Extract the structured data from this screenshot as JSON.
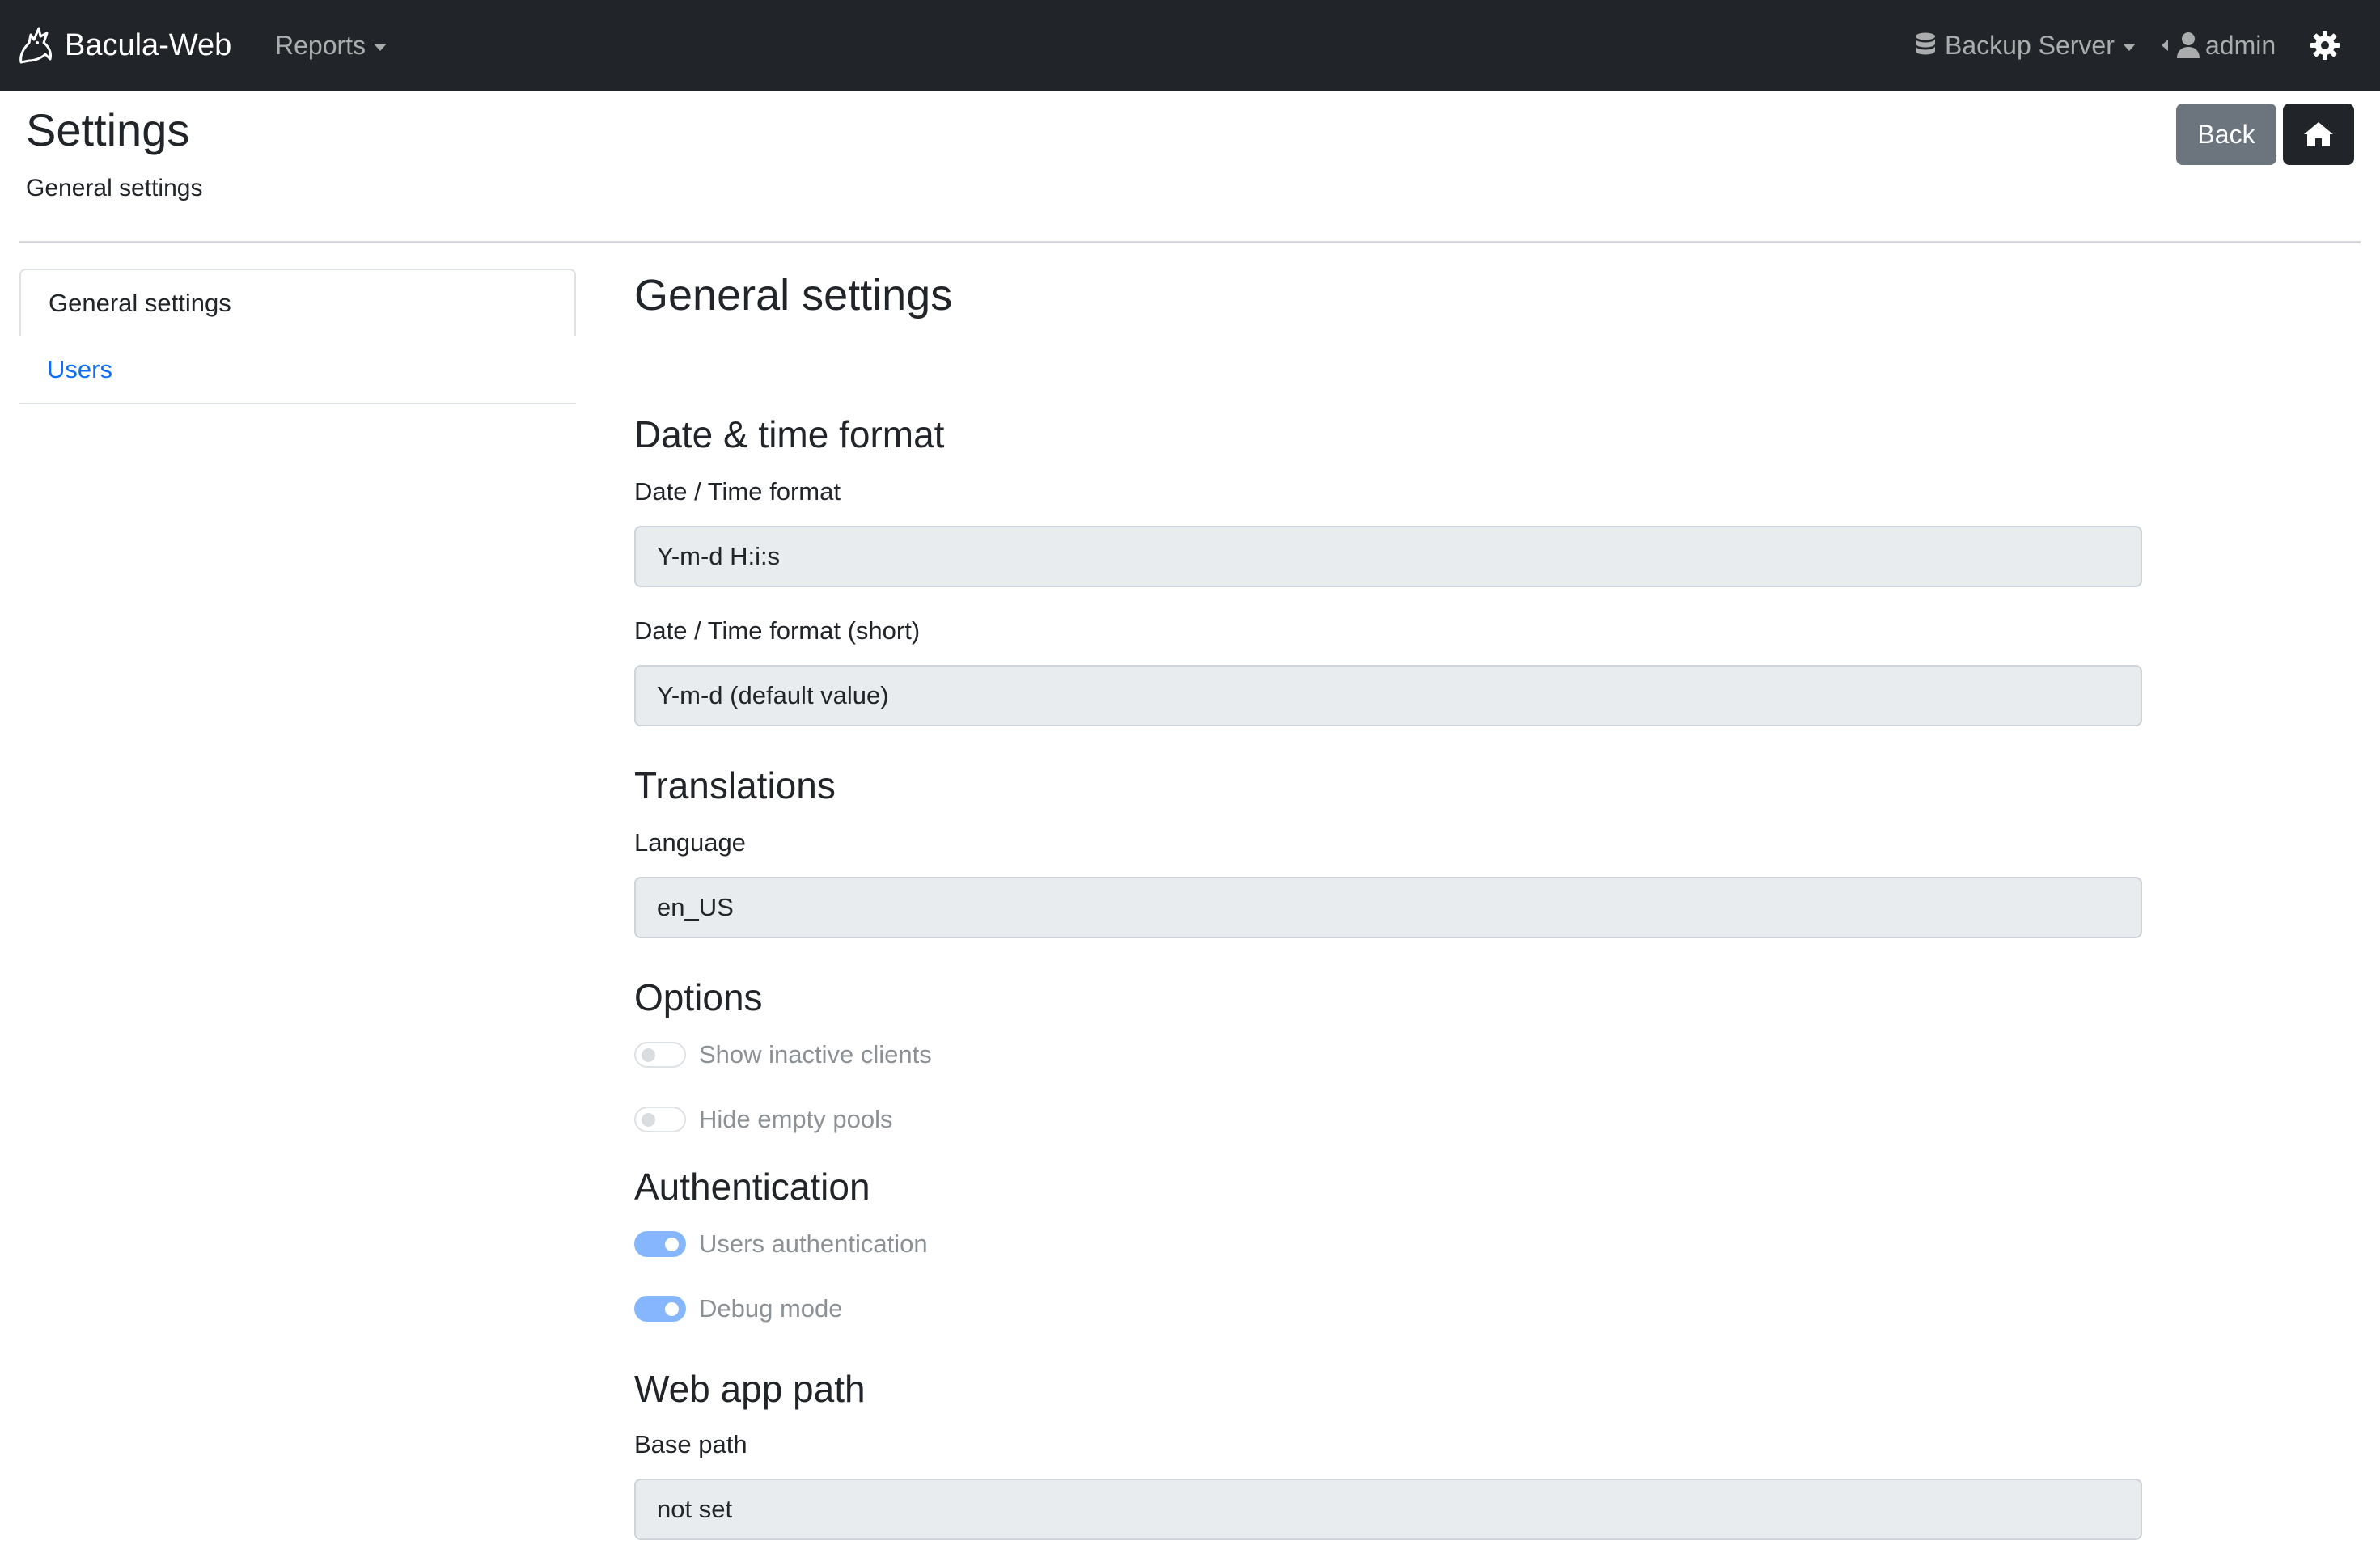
{
  "navbar": {
    "brand": "Bacula-Web",
    "reports_label": "Reports",
    "server_label": "Backup Server",
    "user_label": "admin"
  },
  "header": {
    "title": "Settings",
    "subtitle": "General settings",
    "back_label": "Back"
  },
  "sidebar": {
    "items": [
      {
        "label": "General settings",
        "active": true
      },
      {
        "label": "Users",
        "active": false
      }
    ]
  },
  "main": {
    "title": "General settings",
    "datetime": {
      "heading": "Date & time format",
      "format_label": "Date / Time format",
      "format_value": "Y-m-d H:i:s",
      "short_label": "Date / Time format (short)",
      "short_value": "Y-m-d (default value)"
    },
    "translations": {
      "heading": "Translations",
      "language_label": "Language",
      "language_value": "en_US"
    },
    "options": {
      "heading": "Options",
      "show_inactive_label": "Show inactive clients",
      "show_inactive_on": false,
      "hide_empty_label": "Hide empty pools",
      "hide_empty_on": false
    },
    "authentication": {
      "heading": "Authentication",
      "users_auth_label": "Users authentication",
      "users_auth_on": true,
      "debug_label": "Debug mode",
      "debug_on": true
    },
    "webapp": {
      "heading": "Web app path",
      "base_path_label": "Base path",
      "base_path_value": "not set"
    }
  },
  "colors": {
    "navbar_bg": "#212529",
    "link": "#0d6efd",
    "switch_on": "#86b7fe",
    "back_button": "#6c757d"
  }
}
